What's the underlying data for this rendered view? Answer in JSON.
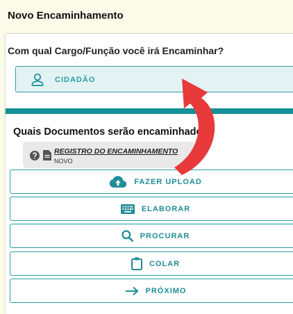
{
  "page_title": "Novo Encaminhamento",
  "cargo": {
    "question": "Com qual Cargo/Função você irá Encaminhar?",
    "selected_label": "CIDADÃO",
    "icon": "person-icon"
  },
  "documentos": {
    "question": "Quais Documentos serão encaminhados?",
    "doc_title": "REGISTRO DO ENCAMINHAMENTO",
    "doc_status": "NOVO"
  },
  "actions": [
    {
      "label": "FAZER UPLOAD",
      "icon": "cloud-upload-icon"
    },
    {
      "label": "ELABORAR",
      "icon": "keyboard-icon"
    },
    {
      "label": "PROCURAR",
      "icon": "search-icon"
    },
    {
      "label": "COLAR",
      "icon": "clipboard-icon"
    },
    {
      "label": "PRÓXIMO",
      "icon": "arrow-right-icon"
    }
  ],
  "colors": {
    "accent": "#149098",
    "annotation_arrow": "#e8393b",
    "background": "#fdfbe9"
  }
}
